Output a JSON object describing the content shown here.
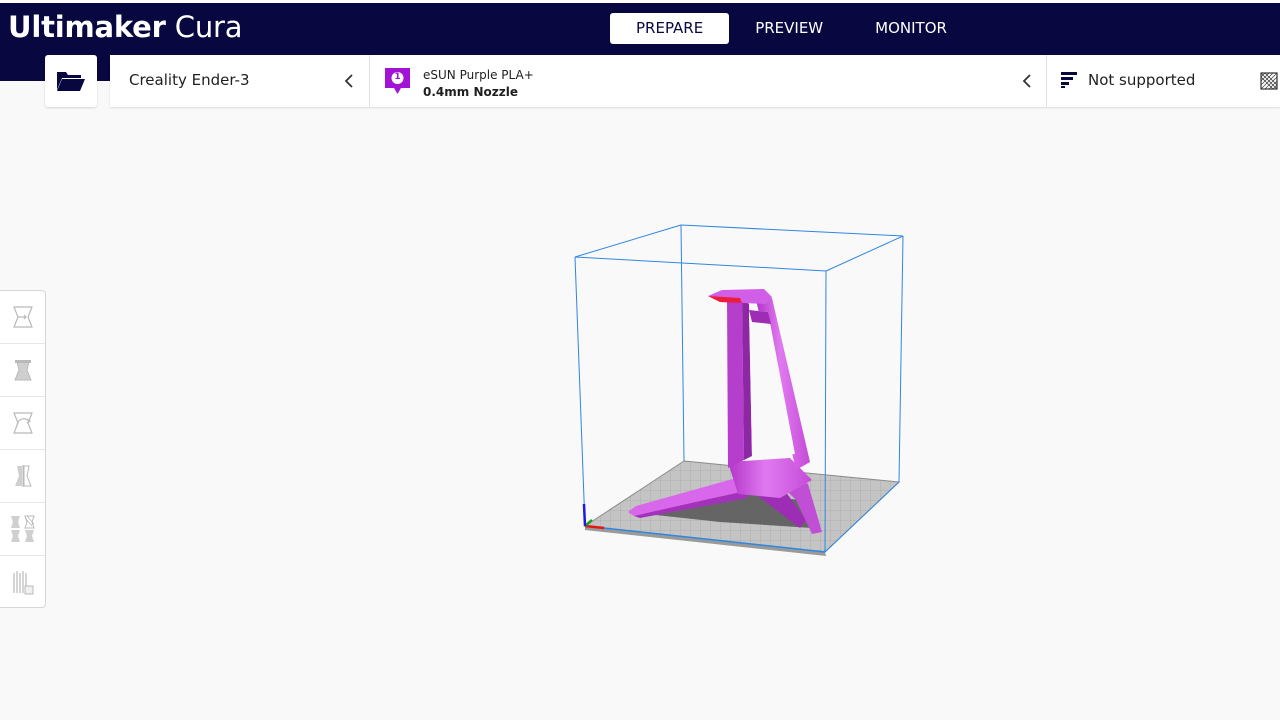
{
  "app": {
    "brand": "Ultimaker",
    "product": "Cura"
  },
  "stages": [
    {
      "label": "PREPARE",
      "active": true
    },
    {
      "label": "PREVIEW",
      "active": false
    },
    {
      "label": "MONITOR",
      "active": false
    }
  ],
  "open_file": {
    "icon": "folder-open-icon"
  },
  "printer": {
    "name": "Creality Ender-3"
  },
  "material": {
    "extruder_number": "1",
    "name": "eSUN Purple PLA+",
    "nozzle": "0.4mm Nozzle",
    "color": "#a213d6"
  },
  "print_settings": {
    "label": "Not supported"
  },
  "toolbar": {
    "tools": [
      {
        "name": "move-tool",
        "icon": "move-icon"
      },
      {
        "name": "scale-tool",
        "icon": "scale-icon"
      },
      {
        "name": "rotate-tool",
        "icon": "rotate-icon"
      },
      {
        "name": "mirror-tool",
        "icon": "mirror-icon"
      },
      {
        "name": "per-model-settings-tool",
        "icon": "per-model-settings-icon"
      },
      {
        "name": "support-blocker-tool",
        "icon": "support-blocker-icon"
      }
    ]
  },
  "colors": {
    "accent": "#08073f",
    "model": "#d45ee8",
    "build_volume": "#2f86e0"
  }
}
